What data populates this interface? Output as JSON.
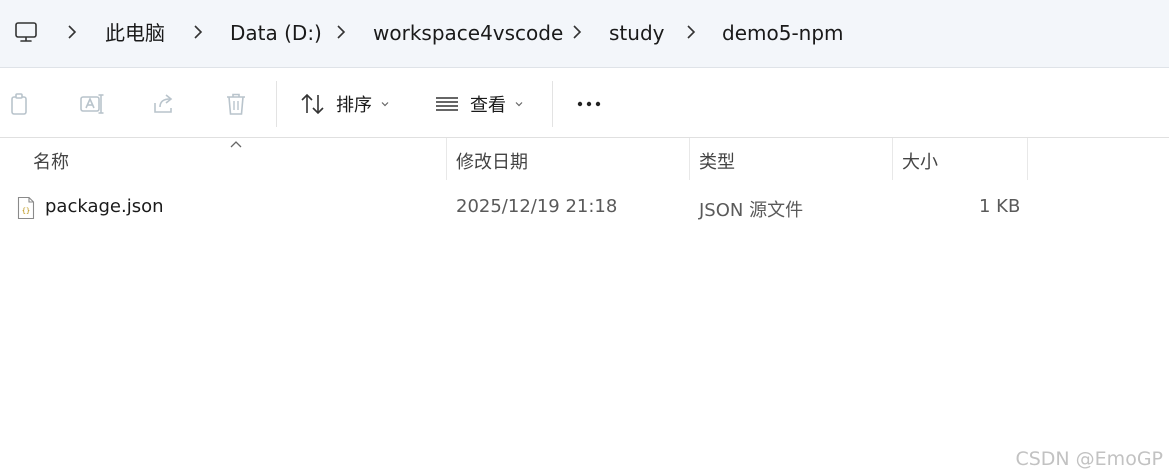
{
  "breadcrumb": {
    "items": [
      "此电脑",
      "Data (D:)",
      "workspace4vscode",
      "study",
      "demo5-npm"
    ]
  },
  "toolbar": {
    "sort_label": "排序",
    "view_label": "查看"
  },
  "columns": {
    "name": "名称",
    "modified": "修改日期",
    "type": "类型",
    "size": "大小"
  },
  "files": [
    {
      "name": "package.json",
      "modified": "2025/12/19 21:18",
      "type": "JSON 源文件",
      "size": "1 KB"
    }
  ],
  "watermark": "CSDN @EmoGP",
  "icons": {
    "computer": "monitor-icon",
    "copy": "copy-icon",
    "rename": "rename-icon",
    "share": "share-icon",
    "delete": "trash-icon",
    "sort": "sort-icon",
    "view": "view-icon",
    "more": "more-icon",
    "file": "json-file-icon"
  },
  "colors": {
    "address_bg": "#f3f6fa",
    "disabled_icon": "#b9c4cc",
    "text": "#1a1a1a",
    "muted_text": "#5a5a5a"
  }
}
